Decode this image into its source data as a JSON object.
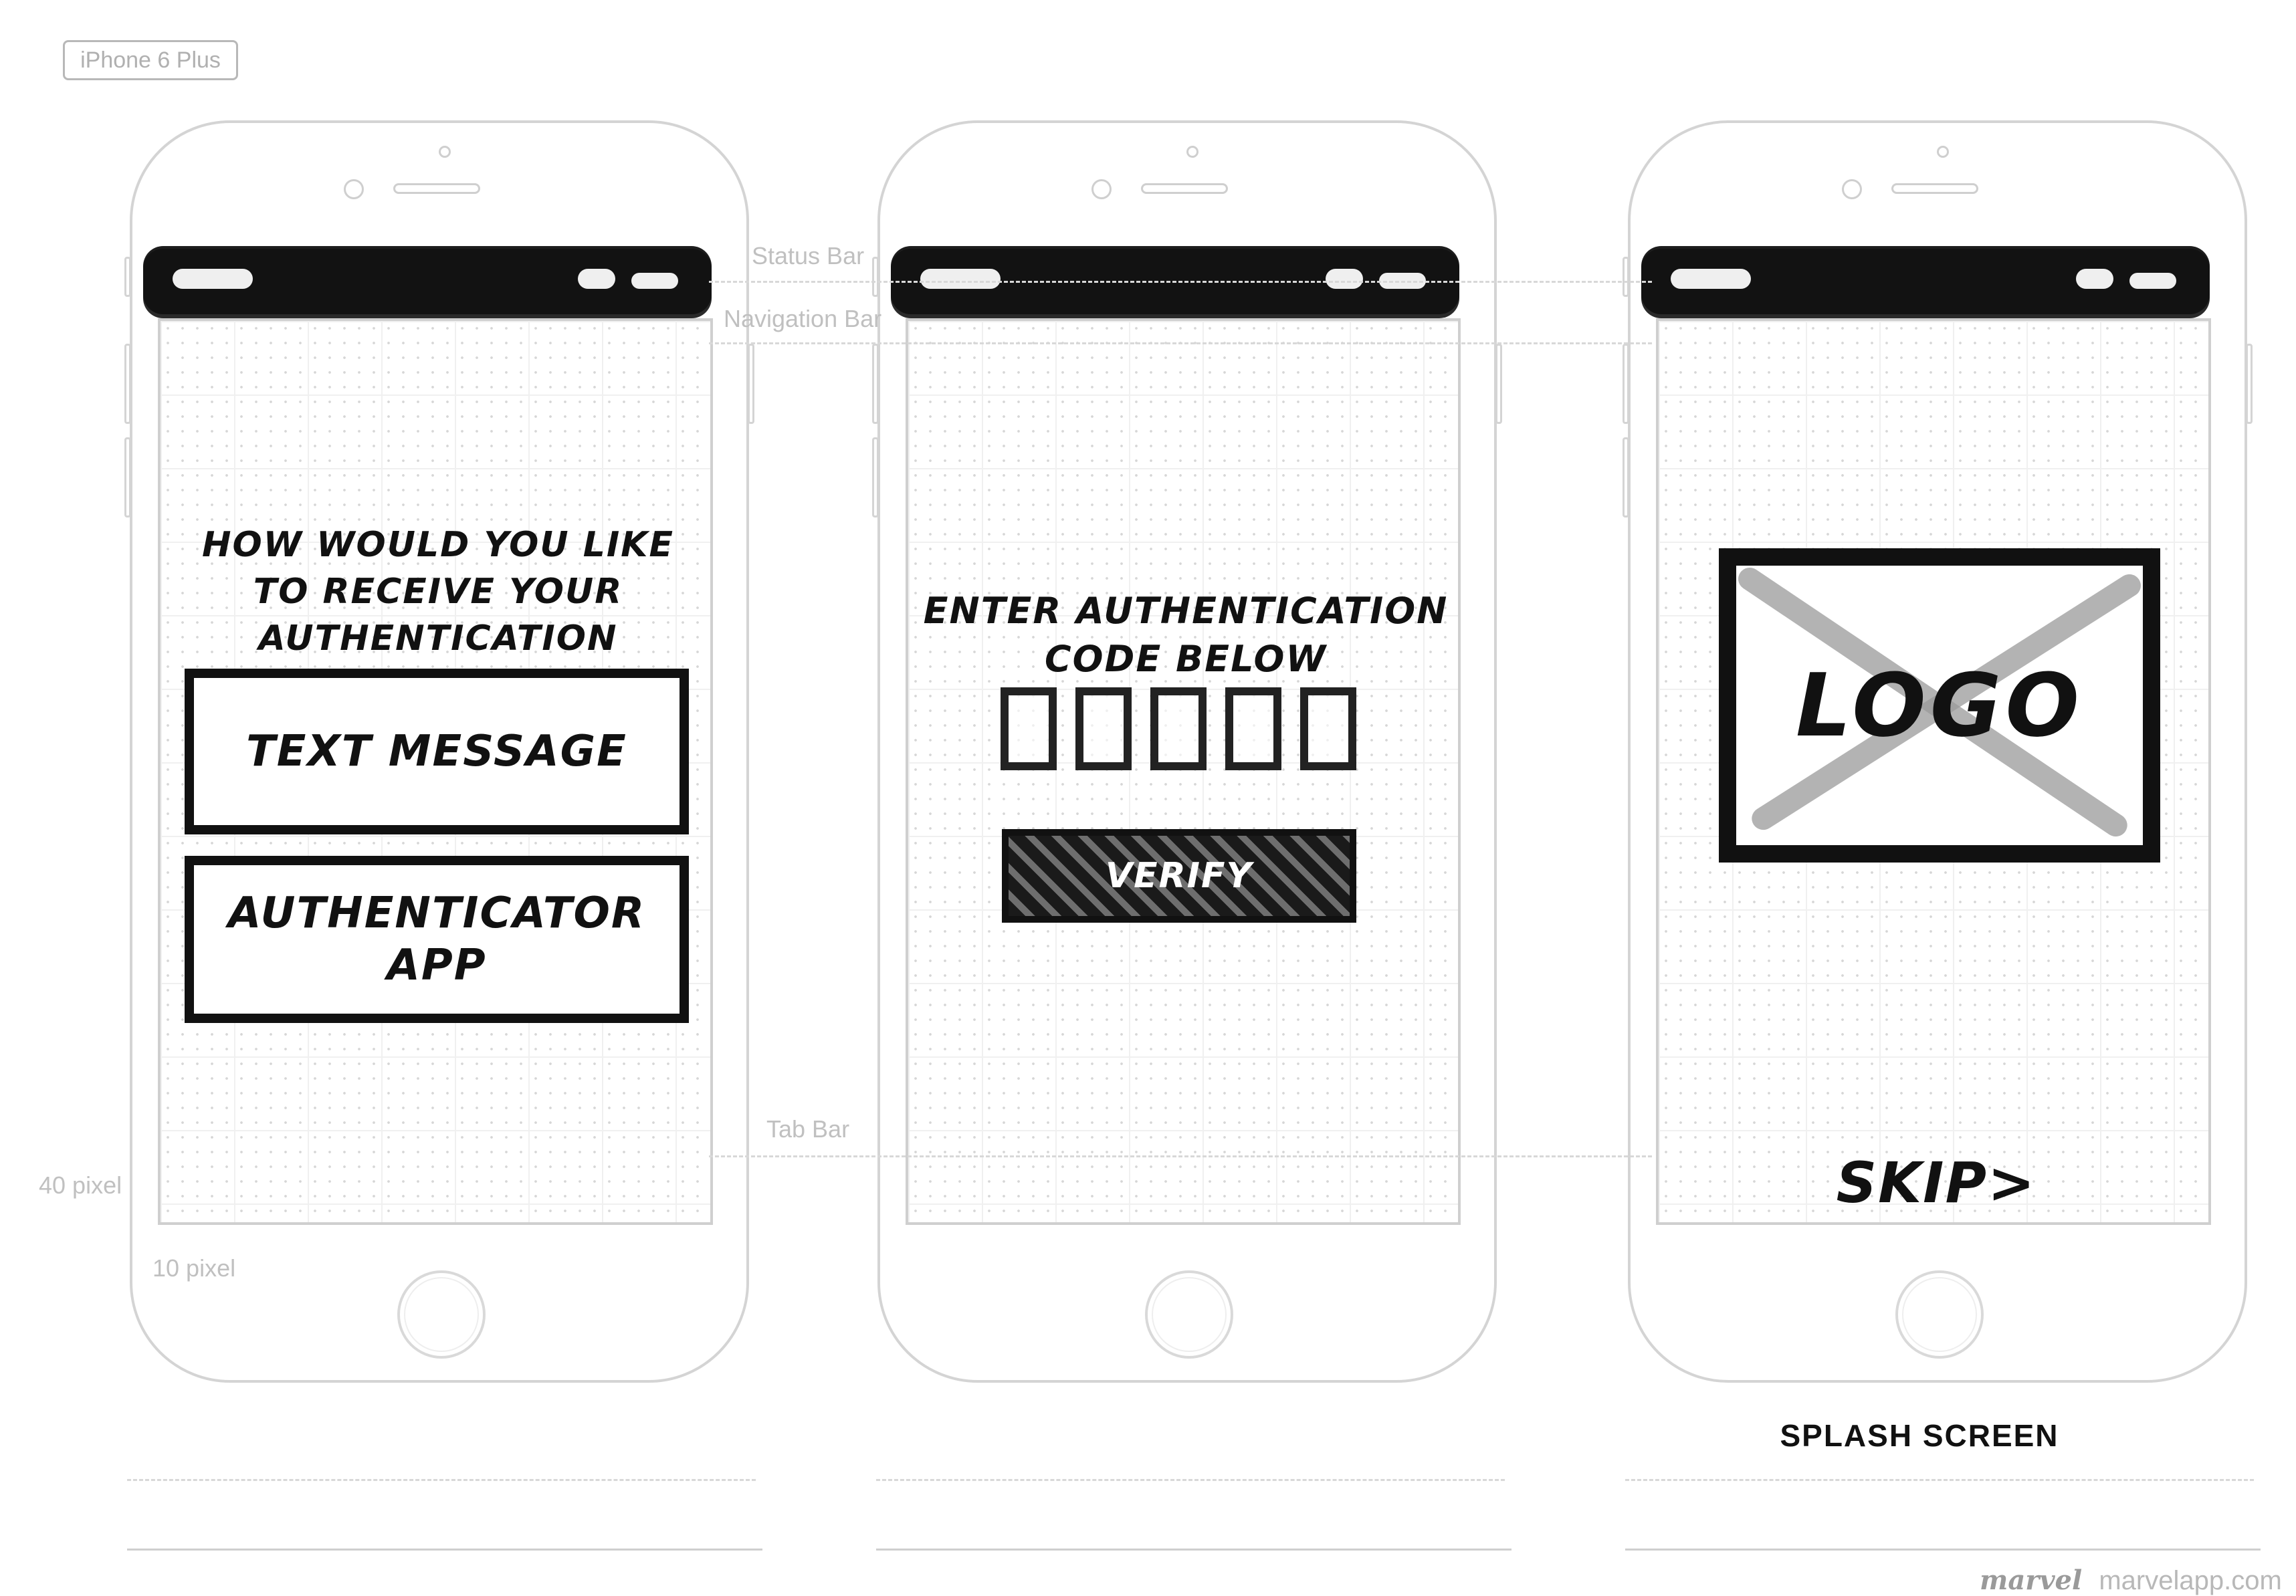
{
  "device_label": "iPhone 6 Plus",
  "annotations": {
    "status_bar": "Status Bar",
    "navigation_bar": "Navigation Bar",
    "tab_bar": "Tab Bar",
    "row_height": "40 pixel",
    "column_width": "10 pixel"
  },
  "screens": [
    {
      "question": "How would you like to receive your authentication code?",
      "options": [
        {
          "label": "Text message"
        },
        {
          "label": "Authenticator app"
        }
      ]
    },
    {
      "title": "Enter authentication code below",
      "code_length": 5,
      "verify_label": "Verify"
    },
    {
      "logo_label": "Logo",
      "skip_label": "Skip>",
      "caption": "SPLASH SCREEN"
    }
  ],
  "footer": {
    "brand_mark": "marvel",
    "brand_url": "marvelapp.com"
  }
}
